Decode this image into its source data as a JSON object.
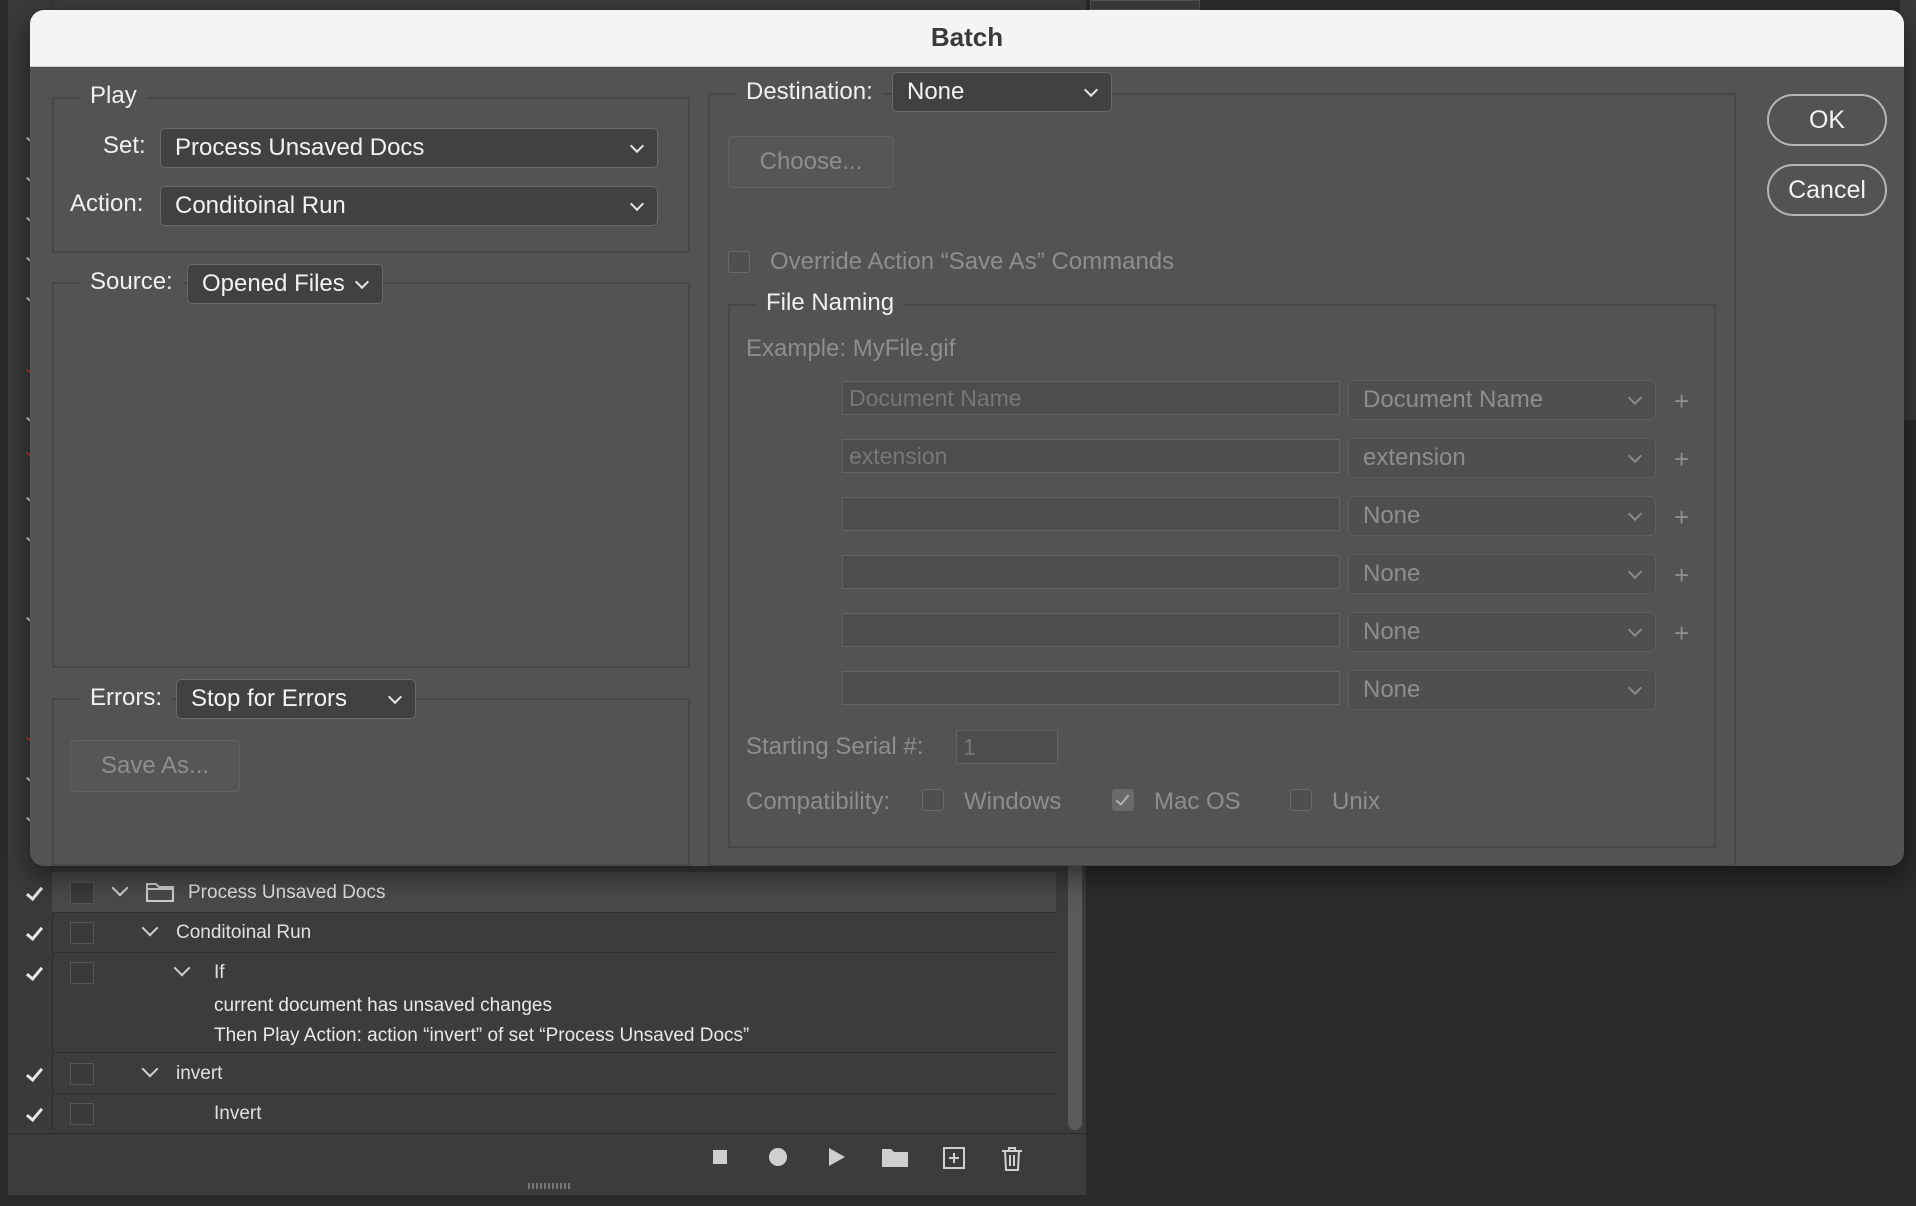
{
  "dialog": {
    "title": "Batch",
    "ok_label": "OK",
    "cancel_label": "Cancel"
  },
  "play": {
    "legend": "Play",
    "set_label": "Set:",
    "set_value": "Process Unsaved Docs",
    "action_label": "Action:",
    "action_value": "Conditoinal Run"
  },
  "source": {
    "label": "Source:",
    "value": "Opened Files"
  },
  "errors": {
    "label": "Errors:",
    "value": "Stop for Errors",
    "save_as_label": "Save As..."
  },
  "destination": {
    "label": "Destination:",
    "value": "None",
    "choose_label": "Choose...",
    "override_label": "Override Action “Save As” Commands"
  },
  "file_naming": {
    "legend": "File Naming",
    "example": "Example: MyFile.gif",
    "rows": [
      {
        "field": "Document Name",
        "select": "Document Name",
        "plus": "+"
      },
      {
        "field": "extension",
        "select": "extension",
        "plus": "+"
      },
      {
        "field": "",
        "select": "None",
        "plus": "+"
      },
      {
        "field": "",
        "select": "None",
        "plus": "+"
      },
      {
        "field": "",
        "select": "None",
        "plus": "+"
      },
      {
        "field": "",
        "select": "None",
        "plus": ""
      }
    ],
    "serial_label": "Starting Serial #:",
    "serial_value": "1",
    "compat_label": "Compatibility:",
    "compat_windows": "Windows",
    "compat_mac": "Mac OS",
    "compat_unix": "Unix"
  },
  "actions_panel": {
    "rows": [
      {
        "label": "Process Unsaved Docs"
      },
      {
        "label": "Conditoinal Run"
      },
      {
        "label": "If"
      },
      {
        "label": "invert"
      },
      {
        "label": "Invert"
      }
    ],
    "condition_line1": "current document has unsaved changes",
    "condition_line2": "Then Play Action: action “invert” of set “Process Unsaved Docs”"
  }
}
